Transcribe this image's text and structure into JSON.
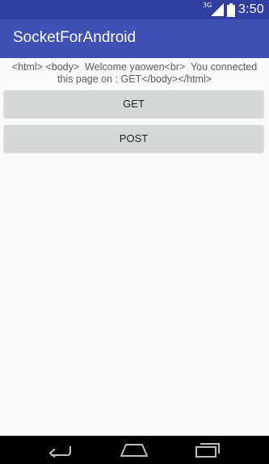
{
  "status_bar": {
    "network_type": "3G",
    "time": "3:50",
    "signal_icon": "cell-signal-icon",
    "battery_icon": "battery-icon"
  },
  "app_bar": {
    "title": "SocketForAndroid",
    "color": "#3F51B5"
  },
  "main": {
    "response_text": "<html> <body>  Welcome yaowen<br>  You connected this page on : GET</body></html>",
    "get_button_label": "GET",
    "post_button_label": "POST"
  },
  "nav_bar": {
    "back_icon": "back-icon",
    "home_icon": "home-icon",
    "recent_icon": "recent-apps-icon"
  },
  "colors": {
    "status_bar": "#303F9F",
    "primary": "#3F51B5",
    "background": "#fafafa",
    "button": "#d6d7d7"
  }
}
